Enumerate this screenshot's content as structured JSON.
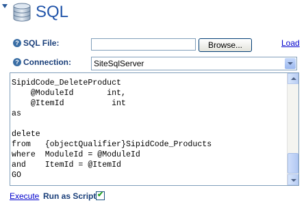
{
  "header": {
    "title": "SQL",
    "collapse_icon": "triangle-down",
    "db_icon": "database-icon"
  },
  "form": {
    "sql_file_label": "SQL File:",
    "sql_file_value": "",
    "browse_label": "Browse...",
    "load_label": "Load",
    "connection_label": "Connection:",
    "connection_value": "SiteSqlServer",
    "help_glyph": "?"
  },
  "editor": {
    "lines": [
      "SipidCode_DeleteProduct",
      "    @ModuleId       int,",
      "    @ItemId          int",
      "as",
      "",
      "delete",
      "from   {objectQualifier}SipidCode_Products",
      "where  ModuleId = @ModuleId",
      "and    ItemId = @ItemId",
      "GO"
    ]
  },
  "footer": {
    "execute_label": "Execute",
    "run_as_script_label": "Run as Script",
    "run_as_script_checked": true
  },
  "colors": {
    "link": "#0000cc",
    "label": "#1a3f7a",
    "title": "#2255aa"
  }
}
